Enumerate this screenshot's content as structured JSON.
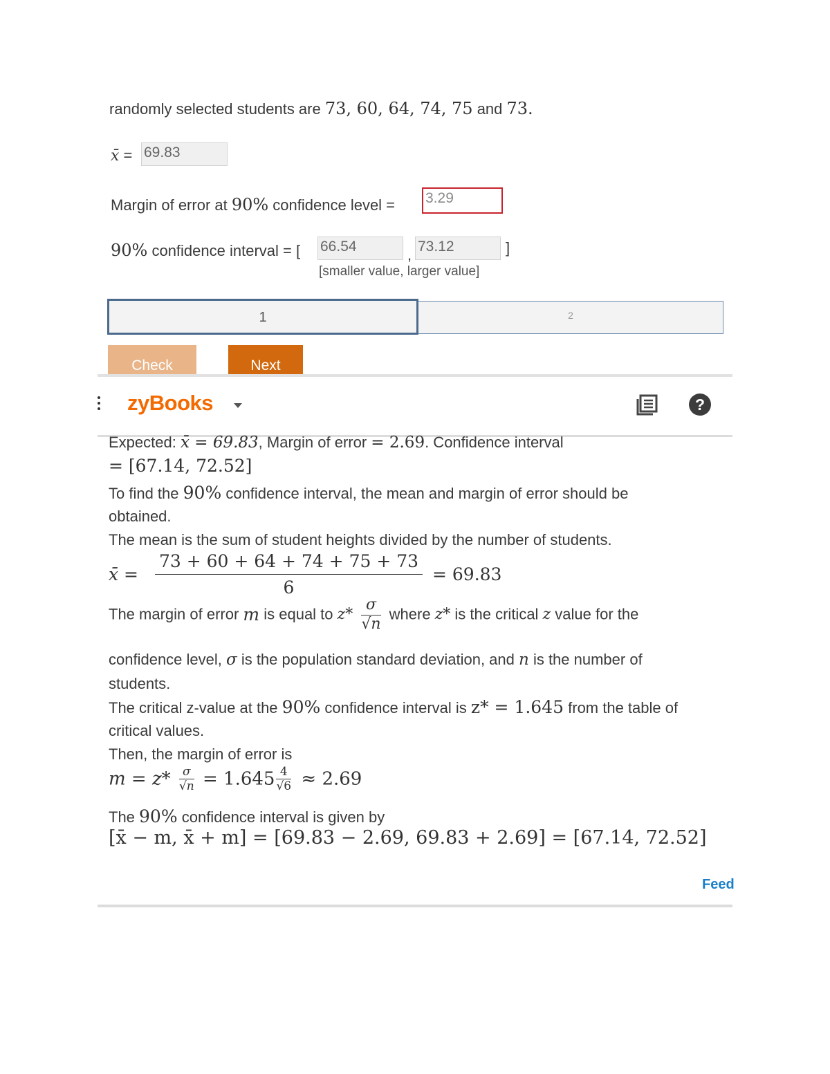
{
  "question": {
    "intro_text": "randomly selected students are ",
    "intro_values": "73, 60, 64, 74, 75",
    "intro_and": " and ",
    "intro_last": "73.",
    "mean_label": "x̄",
    "mean_eq": " = ",
    "mean_value": "69.83",
    "moe_label_pre": "Margin of error at ",
    "moe_pct": "90%",
    "moe_label_post": " confidence level = ",
    "moe_value": "3.29",
    "ci_pct": "90%",
    "ci_label": " confidence interval = [",
    "ci_low": "66.54",
    "ci_comma": ",",
    "ci_high": "73.12",
    "ci_close": "]",
    "ci_hint": "[smaller value, larger value]"
  },
  "tabs": [
    {
      "label": "1"
    },
    {
      "label": "2"
    }
  ],
  "buttons": {
    "check": "Check",
    "next": "Next"
  },
  "header": {
    "menu_icon": "vertical-dots-icon",
    "brand": "zyBooks",
    "dropdown_icon": "caret-down-icon",
    "book_icon": "book-icon",
    "help_icon": "question-icon"
  },
  "solution": {
    "expected_pre": "Expected: ",
    "expected_mean": "x̄ = 69.83",
    "expected_mid": ", Margin of error ",
    "expected_moe": "= 2.69",
    "expected_post": ". Confidence interval",
    "expected_ci": "= [67.14, 72.52]",
    "line1a": "To find the ",
    "line1_pct": "90%",
    "line1b": " confidence interval, the mean and margin of error should be",
    "line2": "obtained.",
    "line3": "The mean is the sum of student heights divided by the number of students.",
    "mean_frac_lhs": "x̄ =",
    "mean_frac_num": "73 + 60 + 64 + 74 + 75 + 73",
    "mean_frac_den": "6",
    "mean_frac_rhs": "= 69.83",
    "moe_line_a": "The margin of error ",
    "moe_m": "m",
    "moe_line_b": " is equal to ",
    "moe_z": "z*",
    "moe_sigma": "σ",
    "moe_sqrt_n": "√n",
    "moe_line_c": " where ",
    "moe_z2": "z*",
    "moe_line_d": " is the critical ",
    "moe_z3": "z",
    "moe_line_e": " value for the",
    "line_cl_a": "confidence level, ",
    "line_cl_sigma": "σ",
    "line_cl_b": " is the population standard deviation, and ",
    "line_cl_n": "n",
    "line_cl_c": " is the number of",
    "line_students": "students.",
    "crit_a": "The critical z-value at the ",
    "crit_pct": "90%",
    "crit_b": " confidence interval is ",
    "crit_z": "z* = 1.645",
    "crit_c": " from the table of",
    "crit_d": "critical values.",
    "then_line": "Then, the margin of error is",
    "calc_lhs": "m = z*",
    "calc_sigma": "σ",
    "calc_sqrtn": "√n",
    "calc_eq": "= 1.645",
    "calc_four": "4",
    "calc_sqrt6": "√6",
    "calc_rhs": "≈ 2.69",
    "ci_line_a": "The ",
    "ci_line_pct": "90%",
    "ci_line_b": " confidence interval is given by",
    "ci_final": "[x̄ − m, x̄ + m] = [69.83 − 2.69, 69.83 + 2.69] = [67.14, 72.52]",
    "feedback": "Feed"
  },
  "colors": {
    "brand": "#f36a00",
    "next_button": "#d2690e",
    "check_button": "#e8b488",
    "error_border": "#c8232c",
    "tab_active_border": "#4b6a8c",
    "feedback_link": "#1a7fc8"
  }
}
